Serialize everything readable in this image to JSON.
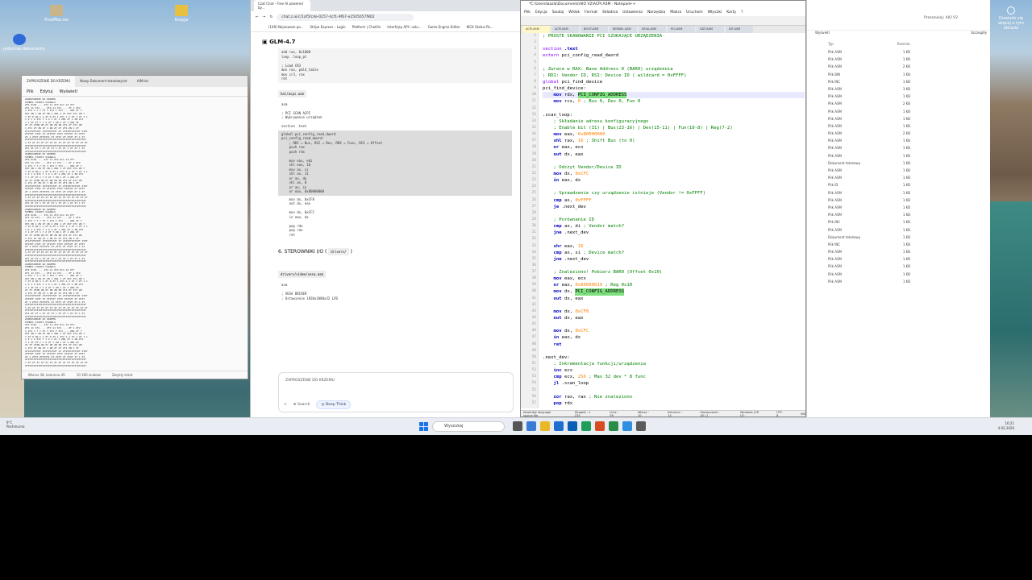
{
  "desktop": {
    "icons": [
      {
        "label": "ProxMox.iso",
        "color": "#c9b58a"
      },
      {
        "label": "Księga",
        "color": "#e8c040"
      },
      {
        "label": "jedzonko.dokumenty",
        "color": "#2f6bd8"
      },
      {
        "label": "Dowiedz się więcej o tym obrazie",
        "color": "#ffffff"
      }
    ]
  },
  "notepad": {
    "tabs": [
      "ZAPROSZENIE DO KRZEMU",
      "Nowy Dokument tekstowy.txt",
      "AIM.txt"
    ],
    "menu": [
      "Plik",
      "Edytuj",
      "Wyświetl"
    ],
    "status": [
      "Wiersz 38, kolumna 45",
      "10 360 znaków",
      "Zwykły tekst"
    ],
    "lines": [
      "ZAPROSZENIE DO KRZEMU",
      "       SYMBOL       STARTS       SIGNALS",
      "   ZT4  0x01 ...  ZT4 11  ZT4  0x1 12  ZT7",
      "   ZT1 11 ST1 ...  ZT4 11 ST1 ...  ZT  1 ZT2",
      "   1 ZT1 7 7 7 ST 7  ZT1 T  ZT1 ...  ZN1 ZT 7",
      "  0ST ZN 1 ZN ZT ZN 1 ZN1 1 ZT 0ST ZT1 ZN 7",
      "  7 ZT 0 SN 1 1 ZT 0 ZT 1 ZT1 1 1 ZT 1 ZT 1 1",
      "  1 Z 1 Z ZT1 T 1 Z  1 ZT 1 ZN1 ZT 1 ZN ZT1",
      "   7 1 ZT ZT  1 7 Z ZT 7 ZN 1 ZT 1 ZN1 ZT",
      "  ZT ZT ZTZN ZN ZT ZN ZN ZN ZT1 ZT ZT1 ZN",
      "   1 ZT1 ZT  ZN ZT 1 ZN ZT ZT ZT1 ZN 1 ZT",
      "  ZT1ZTZTZTZT ZTZTZTZTZT ZT ZTZTZTZTZTZT ZTZT",
      "   ZTZTZT ZTZT ZT ZTZTZT ZTZT ZTZTZT ZT ZTZT",
      "  ZT 1 ZTZT ZTZTZT1 ZT ZTZT ZT ZTZT ZT 1 ZT",
      "  ZTZTZTZTZTZTZTZTZTZTZTZTZTZTZTZTZTZTZTZTZT",
      "  1 ZT ZT ZT ZT ZT ZT ZT ZT ZT ZT ZT ZT ZT ZT",
      "  ZTZTZTZTZTZTZTZTZTZTZTZTZTZTZTZTZTZTZTZTZT",
      "   ZT1 ZT ZT 1 ZT ZT ZT 1 ZT ZT 1 ZT ZT 1 ZT",
      "  ZTZTZTZTZTZTZTZTZTZTZTZTZTZTZTZTZTZTZTZTZT"
    ]
  },
  "browser": {
    "tab": "Czat Chat - Free AI powered by...",
    "url": "chat.z.ai/c/1af5fcde-0257-4cf1-9f67-e2505057f802",
    "bookmarks": [
      "(149) Najnowsze po...",
      "Strīpe Express – Login",
      "Platform | ChatOn",
      "Interfejsy API i usłu...",
      "Game Engine Editor",
      "KICK Status Pa..."
    ],
    "model": "GLM-4.7",
    "file1": "hal/acpi.asm",
    "section": "6. STEROWNIKI I/O",
    "section_code": "drivers/",
    "file2": "drivers/video/vesa.asm",
    "code_top": [
      "add rax, 0x1000",
      "loop .loop_pt",
      "",
      "; Load CR3",
      "mov rax, pml4_table",
      "mov cr3, rax",
      "ret"
    ],
    "code_acpi_a": [
      "asm",
      "",
      "; PCI SCAN ACPI",
      "; Wykrywanie urządzeń",
      "",
      "section .text"
    ],
    "code_acpi_b": [
      "global pci_config_read_dword",
      "pci_config_read_dword:",
      "    ; RDI = Bus, RSI = Dev, RDX = Func, RCX = Offset",
      "    push rax",
      "    push rdx",
      "",
      "    mov eax, edi",
      "    shl eax, 16",
      "    mov ax, si",
      "    shl ax, 11",
      "    or ax, dx",
      "    shl ax, 8",
      "    or ax, cx",
      "    or eax, 0x80000000"
    ],
    "code_acpi_c": [
      "    mov dx, 0xCF8",
      "    out dx, eax",
      "",
      "    mov dx, 0xCFC",
      "    in eax, dx",
      "",
      "    pop rdx",
      "    pop rax",
      "    ret"
    ],
    "code_vesa": [
      "asm",
      "",
      "; VESA DRIVER",
      "; Ustawienie 1920x1080x32 LFB"
    ],
    "chat_placeholder": "ZAPROSZENIE DO KRZEMU",
    "tool_search": "Search",
    "tool_think": "Deep Think"
  },
  "npp": {
    "title": "*C:\\Users\\bazik\\Documents\\AIO V2\\ACPI.ASM - Notepad++",
    "menu": [
      "Plik",
      "Edycja",
      "Szukaj",
      "Widok",
      "Format",
      "Składnia",
      "Ustawienia",
      "Narzędzia",
      "Makra",
      "Uruchom",
      "Wtyczki",
      "Karty",
      "?"
    ],
    "tabs": [
      "ACPI.ASM",
      "ACPI.ASM",
      "BOOT.ASM",
      "KERNEL.ASM",
      "VESA.ASM",
      "PCI.ASM",
      "GDT.ASM",
      "IDT.ASM"
    ],
    "status": [
      "Assembly language source file",
      "Długość : 1 235",
      "Linie : 59",
      "Wiersz : 10",
      "Kolumna : 14",
      "Zaznaczenie : 18 | 1",
      "Windows (CR LF)",
      "UTF-8",
      "INS"
    ]
  },
  "explorer": {
    "search_label": "Przeszukaj: AIO V2",
    "sort_label": "Wyświetl",
    "details_label": "Szczegóły",
    "col_type": "Typ",
    "col_size": "Rozmiar",
    "rows": [
      [
        "Plik ASM",
        "1 KB"
      ],
      [
        "Plik ASM",
        "1 KB"
      ],
      [
        "Plik ASM",
        "2 KB"
      ],
      [
        "Plik BIN",
        "1 KB"
      ],
      [
        "Plik INC",
        "1 KB"
      ],
      [
        "Plik ASM",
        "3 KB"
      ],
      [
        "Plik ASM",
        "1 KB"
      ],
      [
        "Plik ASM",
        "2 KB"
      ],
      [
        "Plik ASM",
        "1 KB"
      ],
      [
        "Plik ASM",
        "1 KB"
      ],
      [
        "Plik ASM",
        "1 KB"
      ],
      [
        "Plik ASM",
        "2 KB"
      ],
      [
        "Plik ASM",
        "1 KB"
      ],
      [
        "Plik ASM",
        "1 KB"
      ],
      [
        "Plik ASM",
        "1 KB"
      ],
      [
        "Dokument tekstowy",
        "1 KB"
      ],
      [
        "Plik ASM",
        "1 KB"
      ],
      [
        "Plik ASM",
        "1 KB"
      ],
      [
        "Plik ID",
        "1 KB"
      ],
      [
        "Plik ASM",
        "1 KB"
      ],
      [
        "Plik ASM",
        "1 KB"
      ],
      [
        "Plik ASM",
        "1 KB"
      ],
      [
        "Plik ASM",
        "1 KB"
      ],
      [
        "Plik INC",
        "1 KB"
      ],
      [
        "Plik ASM",
        "1 KB"
      ],
      [
        "Dokument tekstowy",
        "1 KB"
      ],
      [
        "Plik INC",
        "1 KB"
      ],
      [
        "Plik ASM",
        "1 KB"
      ],
      [
        "Plik ASM",
        "1 KB"
      ],
      [
        "Plik ASM",
        "1 KB"
      ],
      [
        "Plik ASM",
        "1 KB"
      ],
      [
        "Plik ASM",
        "1 KB"
      ]
    ]
  },
  "taskbar": {
    "weather_temp": "9°C",
    "weather_desc": "Pochmurno",
    "search": "Wyszukaj",
    "time": "16:21",
    "date": "4.02.2026"
  }
}
